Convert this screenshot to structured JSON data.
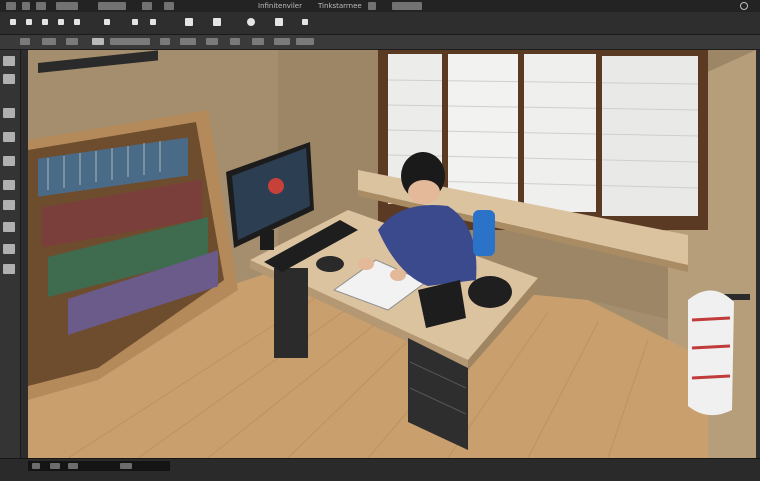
{
  "window": {
    "menu_labels": [
      "Infinitenviler",
      "Tinkstarrnee"
    ]
  },
  "toolbar": {
    "tools": [
      {
        "name": "lasso-icon"
      },
      {
        "name": "image-icon"
      },
      {
        "name": "mask-icon"
      },
      {
        "name": "rotate-icon"
      },
      {
        "name": "brush-icon"
      },
      {
        "name": "pen-icon"
      }
    ]
  },
  "left_panel": {
    "tools": [
      "move-tool",
      "marquee-tool",
      "lasso-tool",
      "crop-tool",
      "eyedropper-tool",
      "brush-tool",
      "eraser-tool",
      "gradient-tool",
      "text-tool",
      "zoom-tool"
    ]
  },
  "canvas": {
    "scene": "room",
    "colors": {
      "wall": "#a58e6d",
      "floor": "#c99f6e",
      "desk": "#dcc3a0",
      "shelf": "#b48a5a",
      "sweater": "#3b4a8c",
      "chair": "#2a73c9"
    }
  }
}
